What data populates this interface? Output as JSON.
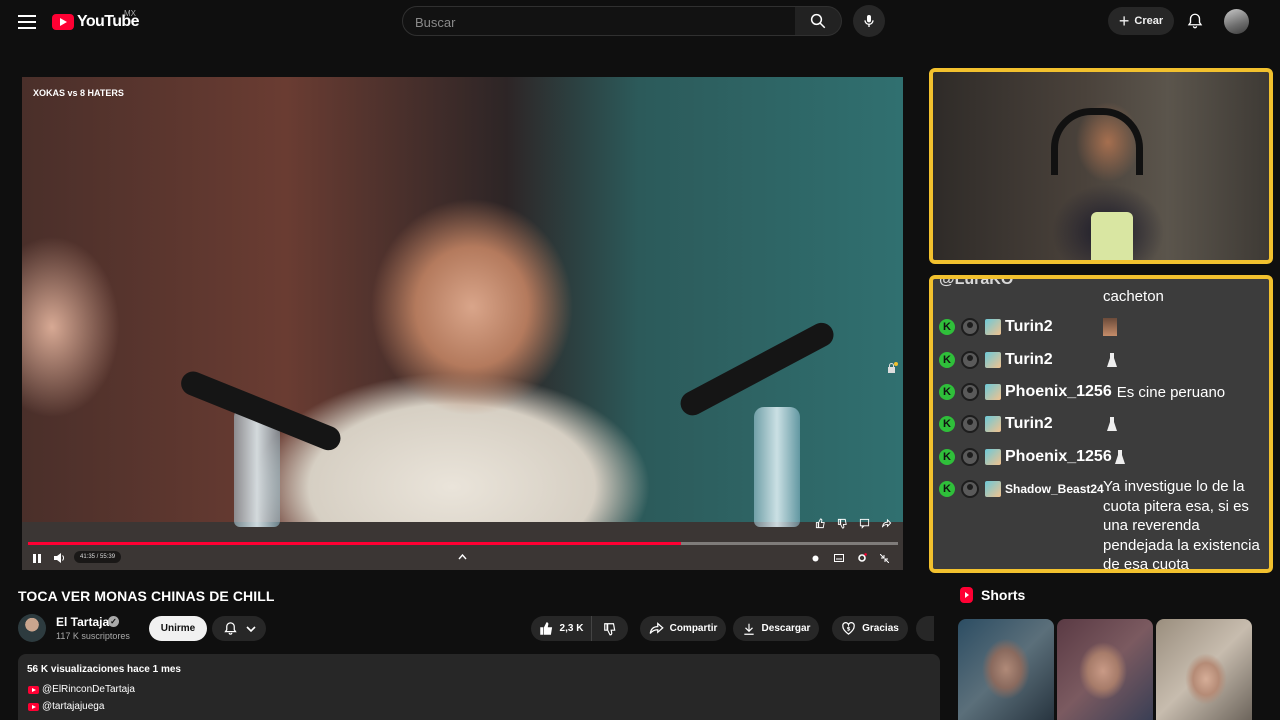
{
  "header": {
    "logo_text": "YouTube",
    "country_code": "MX",
    "search_placeholder": "Buscar",
    "create_label": "Crear"
  },
  "player": {
    "overlay_title": "XOKAS vs 8 HATERS",
    "time": "41:35 / 55:39",
    "progress_fraction": 0.75
  },
  "chat": {
    "top_partial_name": "@LuraKO",
    "top_message": "cacheton",
    "rows": [
      {
        "name": "Turin2",
        "message": ""
      },
      {
        "name": "Turin2",
        "message": ""
      },
      {
        "name": "Phoenix_1256",
        "message": "Es cine peruano"
      },
      {
        "name": "Turin2",
        "message": ""
      },
      {
        "name": "Phoenix_1256",
        "message": ""
      },
      {
        "name": "Shadow_Beast24",
        "message": "Ya investigue lo de la cuota pitera esa, si es una reverenda pendejada la existencia de esa cuota"
      }
    ]
  },
  "video": {
    "title": "TOCA VER MONAS CHINAS DE CHILL",
    "channel_name": "El Tartaja",
    "subscribers": "117 K suscriptores",
    "join_label": "Unirme",
    "likes": "2,3 K",
    "share_label": "Compartir",
    "download_label": "Descargar",
    "thanks_label": "Gracias"
  },
  "description": {
    "meta": "56 K visualizaciones  hace 1 mes",
    "links": [
      "@ElRinconDeTartaja",
      "@tartajajuega"
    ]
  },
  "shorts": {
    "heading": "Shorts"
  },
  "colors": {
    "accent_red": "#ff0033",
    "stream_frame": "#f2c12e",
    "kick_green": "#2fbf3a"
  }
}
